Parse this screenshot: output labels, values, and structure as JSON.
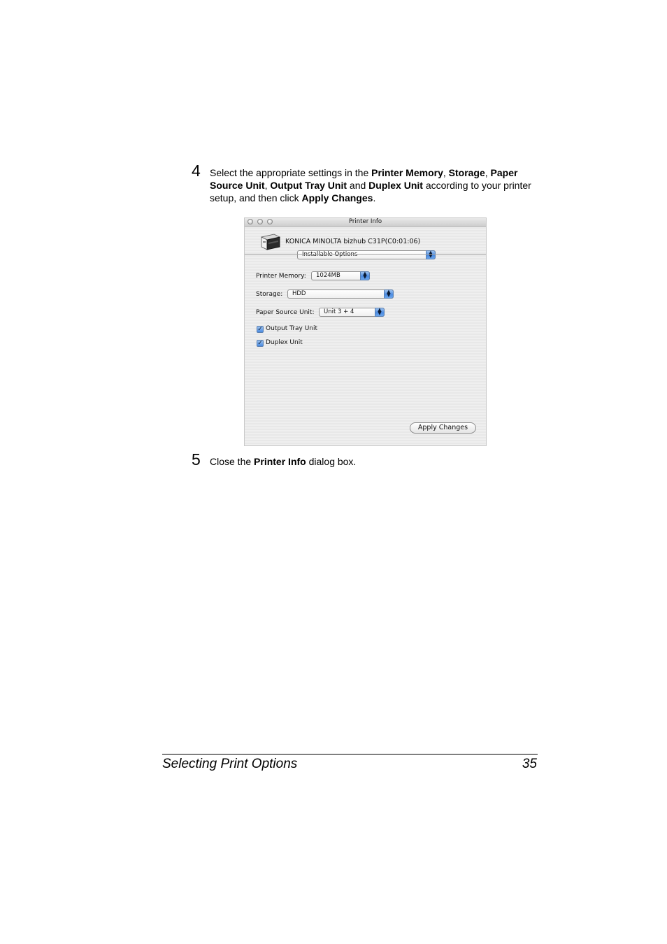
{
  "step4": {
    "number": "4",
    "parts": [
      "Select the appropriate settings in the ",
      "Printer Memory",
      ", ",
      "Storage",
      ", ",
      "Paper Source Unit",
      ", ",
      "Output Tray Unit",
      " and ",
      "Duplex Unit",
      " according to your printer setup, and then click ",
      "Apply Changes",
      "."
    ]
  },
  "dialog": {
    "title": "Printer Info",
    "printer_name": "KONICA MINOLTA bizhub C31P(C0:01:06)",
    "section_popup": "Installable Options",
    "memory_label": "Printer Memory:",
    "memory_value": "1024MB",
    "storage_label": "Storage:",
    "storage_value": "HDD",
    "paper_source_label": "Paper Source Unit:",
    "paper_source_value": "Unit 3 + 4",
    "output_tray_label": "Output Tray Unit",
    "duplex_label": "Duplex Unit",
    "apply_label": "Apply Changes"
  },
  "step5": {
    "number": "5",
    "parts": [
      "Close the ",
      "Printer Info",
      " dialog box."
    ]
  },
  "footer": {
    "title": "Selecting Print Options",
    "page": "35"
  }
}
